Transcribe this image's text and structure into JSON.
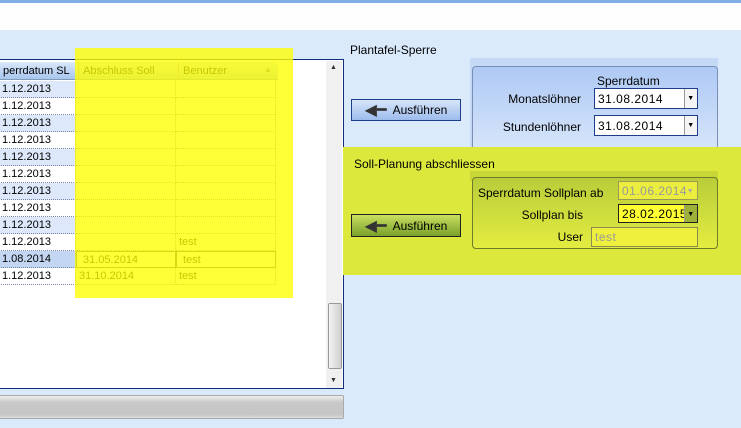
{
  "grid": {
    "columns": [
      "perrdatum SL",
      "Abschluss Soll",
      "Benutzer"
    ],
    "rows": [
      [
        "1.12.2013",
        "",
        ""
      ],
      [
        "1.12.2013",
        "",
        ""
      ],
      [
        "1.12.2013",
        "",
        ""
      ],
      [
        "1.12.2013",
        "",
        ""
      ],
      [
        "1.12.2013",
        "",
        ""
      ],
      [
        "1.12.2013",
        "",
        ""
      ],
      [
        "1.12.2013",
        "",
        ""
      ],
      [
        "1.12.2013",
        "",
        ""
      ],
      [
        "1.12.2013",
        "",
        ""
      ],
      [
        "1.12.2013",
        "",
        "test"
      ],
      [
        "1.08.2014",
        "31.05.2014",
        "test"
      ],
      [
        "1.12.2013",
        "31.10.2014",
        "test"
      ]
    ]
  },
  "plantafel": {
    "title": "Plantafel-Sperre",
    "execute": "Ausführen",
    "sperrdatum": "Sperrdatum",
    "monat_label": "Monatslöhner",
    "monat_value": "31.08.2014",
    "stunden_label": "Stundenlöhner",
    "stunden_value": "31.08.2014"
  },
  "soll": {
    "title": "Soll-Planung abschliessen",
    "execute": "Ausführen",
    "ab_label": "Sperrdatum  Sollplan ab",
    "ab_value": "01.06.2014",
    "bis_label": "Sollplan bis",
    "bis_value": "28.02.2015",
    "user_label": "User",
    "user_value": "test"
  },
  "colors": {
    "highlight": "#ffff00",
    "panel": "#dce83c",
    "background": "#dbeafb"
  }
}
